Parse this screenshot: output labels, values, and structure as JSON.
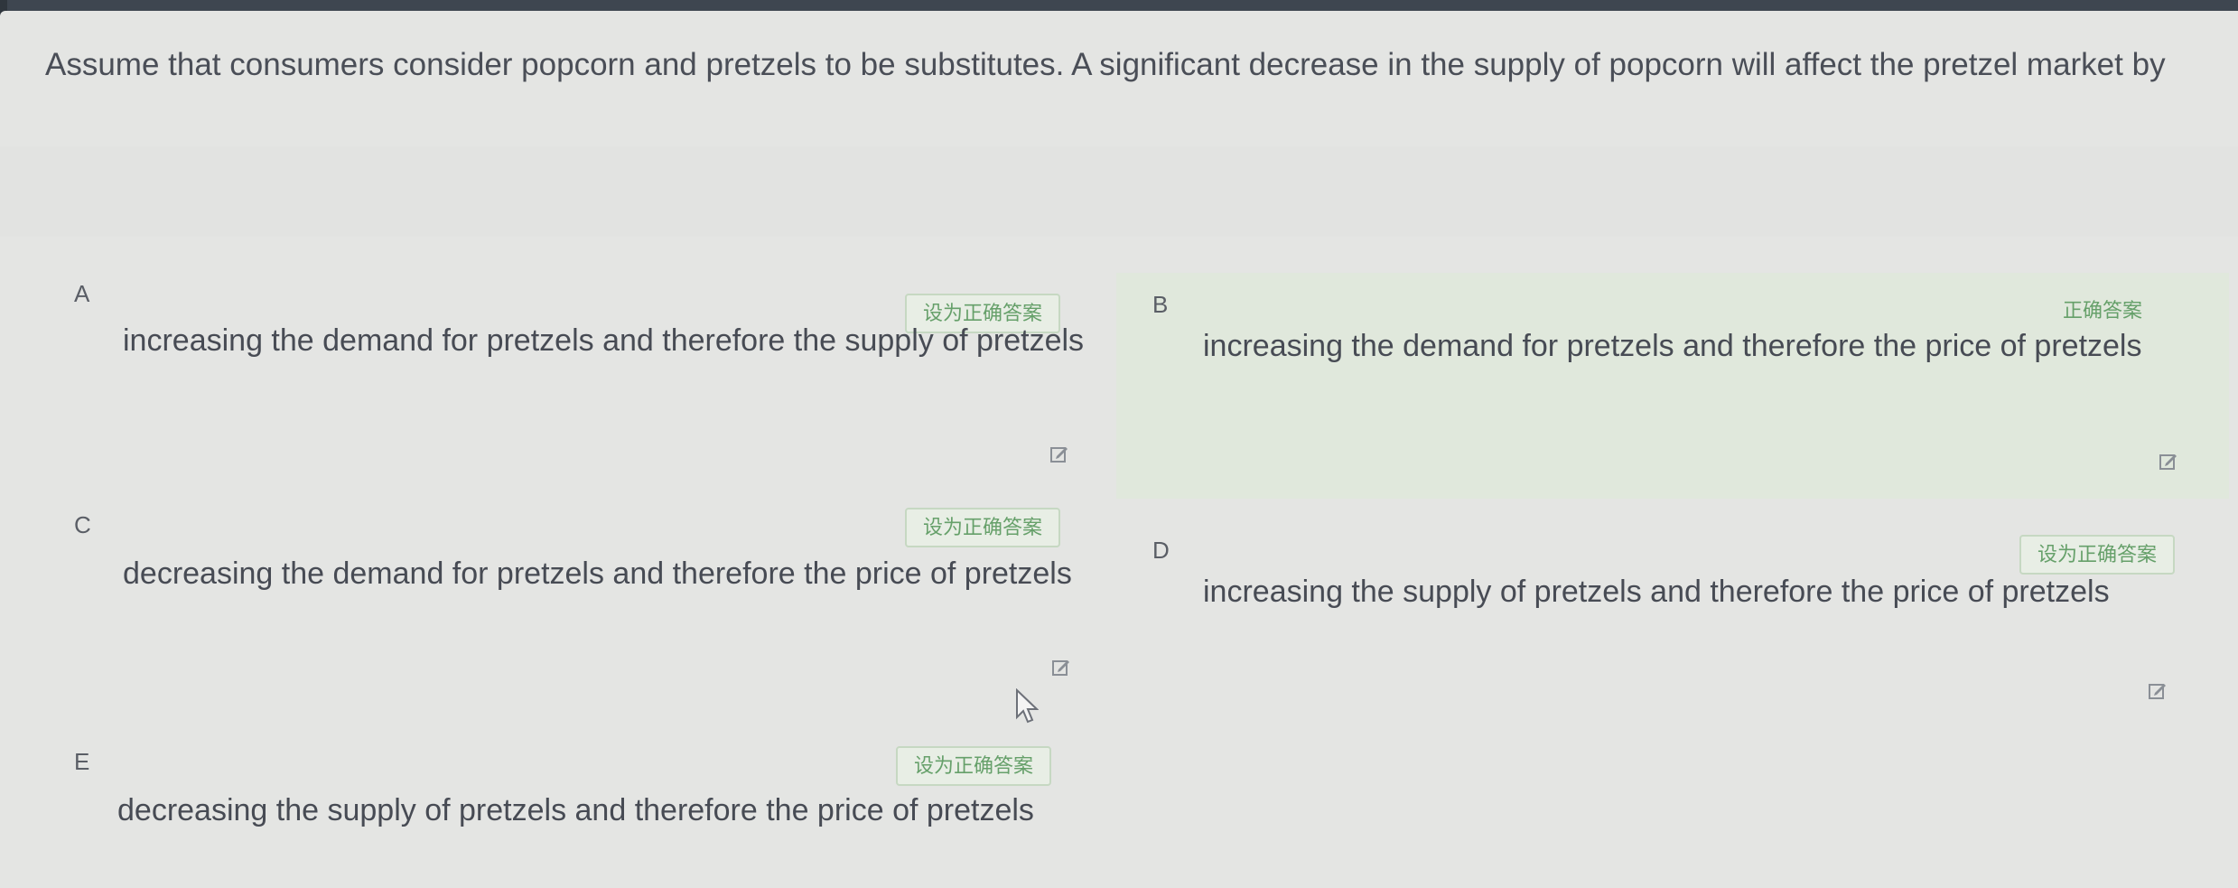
{
  "question": {
    "text": "Assume that consumers consider popcorn and pretzels to be substitutes. A significant decrease in the supply of popcorn will affect the pretzel market by"
  },
  "options": [
    {
      "letter": "A",
      "text": "increasing the demand for pretzels and therefore the supply of pretzels",
      "button": "设为正确答案"
    },
    {
      "letter": "B",
      "text": "increasing the demand for pretzels and therefore the price of pretzels",
      "button": "正确答案"
    },
    {
      "letter": "C",
      "text": "decreasing the demand for pretzels and therefore the price of pretzels",
      "button": "设为正确答案"
    },
    {
      "letter": "D",
      "text": "increasing the supply of pretzels and therefore the price of pretzels",
      "button": "设为正确答案"
    },
    {
      "letter": "E",
      "text": "decreasing the supply of pretzels and therefore the price of pretzels",
      "button": "设为正确答案"
    }
  ],
  "colors": {
    "selected_background": "#e0e8dc",
    "accent_green": "#66a06a",
    "text": "#474b54"
  },
  "icons": [
    "edit-icon",
    "mouse-pointer-icon"
  ]
}
